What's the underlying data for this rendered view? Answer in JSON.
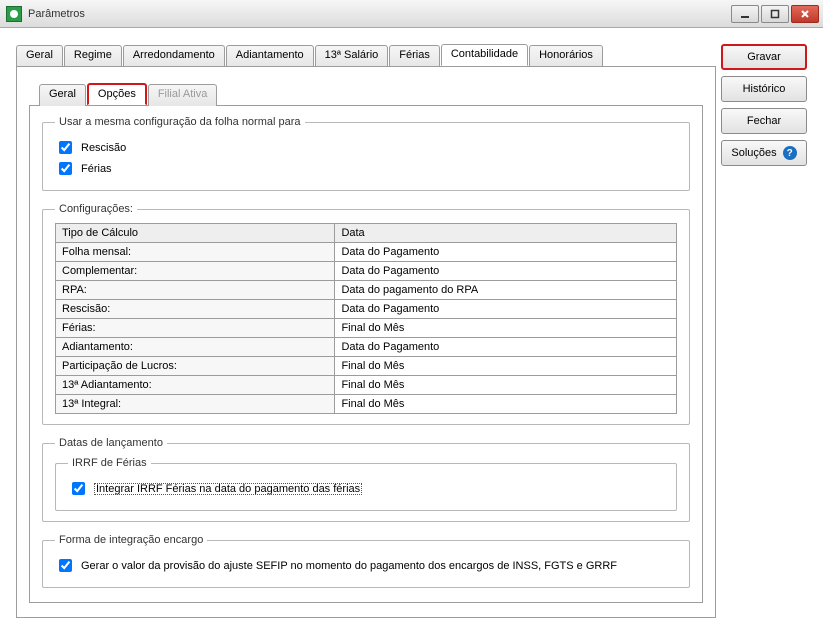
{
  "window": {
    "title": "Parâmetros"
  },
  "side": {
    "gravar": "Gravar",
    "historico": "Histórico",
    "fechar": "Fechar",
    "solucoes": "Soluções"
  },
  "main_tabs": {
    "geral": "Geral",
    "regime": "Regime",
    "arredondamento": "Arredondamento",
    "adiantamento": "Adiantamento",
    "salario13": "13ª Salário",
    "ferias": "Férias",
    "contabilidade": "Contabilidade",
    "honorarios": "Honorários"
  },
  "sub_tabs": {
    "geral": "Geral",
    "opcoes": "Opções",
    "filial": "Filial Ativa"
  },
  "group_same_config": {
    "legend": "Usar a mesma configuração da folha normal para",
    "rescisao": "Rescisão",
    "ferias": "Férias"
  },
  "group_config": {
    "legend": "Configurações:",
    "header_tipo": "Tipo de Cálculo",
    "header_data": "Data",
    "rows": [
      {
        "tipo": "Folha mensal:",
        "data": "Data do Pagamento"
      },
      {
        "tipo": "Complementar:",
        "data": "Data do Pagamento"
      },
      {
        "tipo": "RPA:",
        "data": "Data do pagamento do RPA"
      },
      {
        "tipo": "Rescisão:",
        "data": "Data do Pagamento"
      },
      {
        "tipo": "Férias:",
        "data": "Final do Mês"
      },
      {
        "tipo": "Adiantamento:",
        "data": "Data do Pagamento"
      },
      {
        "tipo": "Participação de Lucros:",
        "data": "Final do Mês"
      },
      {
        "tipo": "13ª Adiantamento:",
        "data": "Final do Mês"
      },
      {
        "tipo": "13ª Integral:",
        "data": "Final do Mês"
      }
    ]
  },
  "group_datas": {
    "legend": "Datas de lançamento",
    "irrf_legend": "IRRF de Férias",
    "irrf_label": "Integrar IRRF Férias na data do pagamento das férias"
  },
  "group_encargo": {
    "legend": "Forma de integração encargo",
    "label": "Gerar o valor da provisão do ajuste SEFIP no momento do pagamento dos encargos de INSS, FGTS e GRRF"
  }
}
